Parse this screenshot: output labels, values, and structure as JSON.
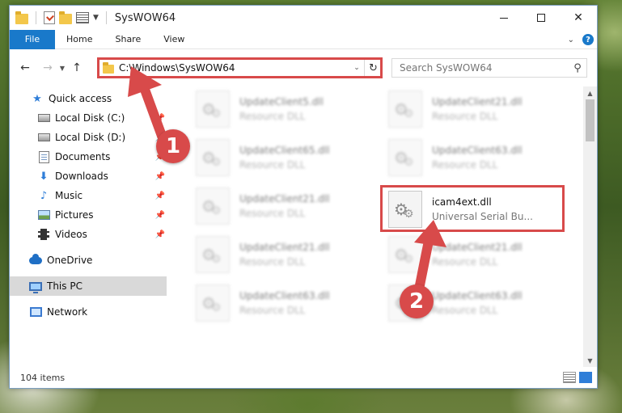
{
  "window": {
    "title": "SysWOW64",
    "controls": {
      "minimize": "",
      "maximize": "",
      "close": "✕"
    }
  },
  "ribbon": {
    "tabs": [
      "File",
      "Home",
      "Share",
      "View"
    ]
  },
  "navbar": {
    "address": "C:\\Windows\\SysWOW64",
    "search_placeholder": "Search SysWOW64"
  },
  "sidebar": {
    "items": [
      {
        "label": "Quick access",
        "icon": "star-icon",
        "pinned": false
      },
      {
        "label": "Local Disk (C:)",
        "icon": "disk-icon",
        "pinned": true
      },
      {
        "label": "Local Disk (D:)",
        "icon": "disk-icon",
        "pinned": true
      },
      {
        "label": "Documents",
        "icon": "documents-icon",
        "pinned": true
      },
      {
        "label": "Downloads",
        "icon": "downloads-icon",
        "pinned": true
      },
      {
        "label": "Music",
        "icon": "music-icon",
        "pinned": true
      },
      {
        "label": "Pictures",
        "icon": "pictures-icon",
        "pinned": true
      },
      {
        "label": "Videos",
        "icon": "videos-icon",
        "pinned": true
      },
      {
        "label": "OneDrive",
        "icon": "onedrive-icon",
        "pinned": false
      },
      {
        "label": "This PC",
        "icon": "this-pc-icon",
        "pinned": false,
        "selected": true
      },
      {
        "label": "Network",
        "icon": "network-icon",
        "pinned": false
      }
    ]
  },
  "files": [
    {
      "name": "UpdateClient5.dll",
      "desc": "Resource DLL",
      "blurred": true
    },
    {
      "name": "UpdateClient21.dll",
      "desc": "Resource DLL",
      "blurred": true
    },
    {
      "name": "UpdateClient65.dll",
      "desc": "Resource DLL",
      "blurred": true
    },
    {
      "name": "UpdateClient63.dll",
      "desc": "Resource DLL",
      "blurred": true
    },
    {
      "name": "UpdateClient21.dll",
      "desc": "Resource DLL",
      "blurred": true
    },
    {
      "name": "icam4ext.dll",
      "desc": "Universal Serial Bu...",
      "blurred": false
    },
    {
      "name": "UpdateClient21.dll",
      "desc": "Resource DLL",
      "blurred": true
    },
    {
      "name": "UpdateClient21.dll",
      "desc": "Resource DLL",
      "blurred": true
    },
    {
      "name": "UpdateClient63.dll",
      "desc": "Resource DLL",
      "blurred": true
    },
    {
      "name": "UpdateClient63.dll",
      "desc": "Resource DLL",
      "blurred": true
    }
  ],
  "status": {
    "count": "104 items"
  },
  "annotations": {
    "step1": "1",
    "step2": "2"
  },
  "colors": {
    "accent": "#1979ca",
    "highlight": "#d84a4a"
  }
}
